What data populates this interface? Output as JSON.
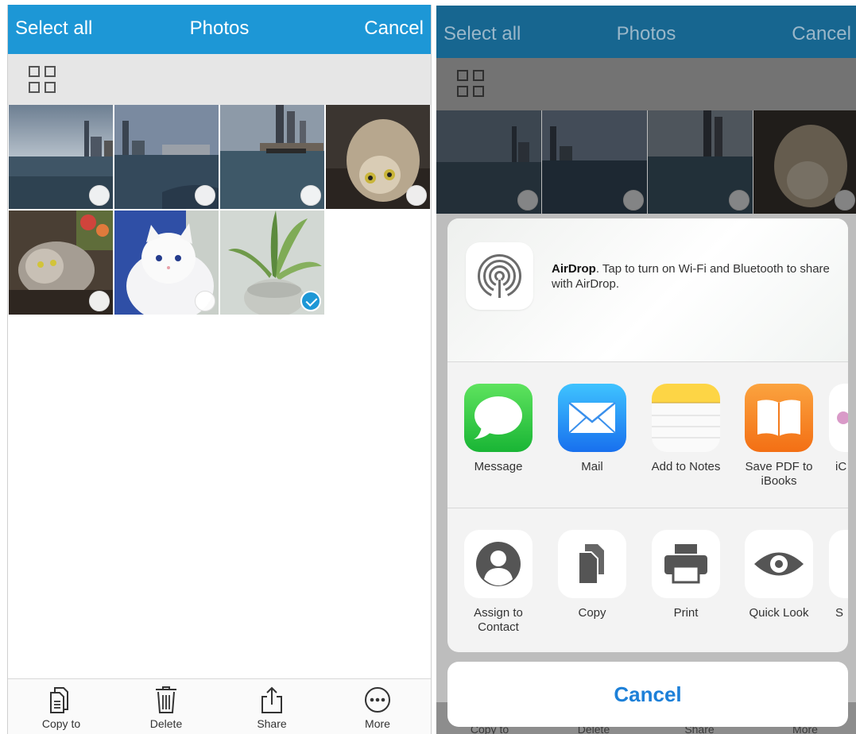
{
  "left": {
    "nav": {
      "select_all": "Select all",
      "title": "Photos",
      "cancel": "Cancel"
    },
    "photos": [
      {
        "kind": "harbor",
        "selected": false
      },
      {
        "kind": "harbor",
        "selected": false
      },
      {
        "kind": "harbor",
        "selected": false
      },
      {
        "kind": "cat",
        "selected": false
      },
      {
        "kind": "cat",
        "selected": false
      },
      {
        "kind": "cat",
        "selected": false
      },
      {
        "kind": "plant",
        "selected": true
      }
    ],
    "bottom": {
      "copy_to": "Copy to",
      "delete": "Delete",
      "share": "Share",
      "more": "More"
    }
  },
  "right": {
    "nav": {
      "select_all": "Select all",
      "title": "Photos",
      "cancel": "Cancel"
    },
    "airdrop": {
      "title": "AirDrop",
      "text": ". Tap to turn on Wi-Fi and Bluetooth to share with AirDrop."
    },
    "apps": [
      {
        "label": "Message",
        "icon": "message-icon"
      },
      {
        "label": "Mail",
        "icon": "mail-icon"
      },
      {
        "label": "Add to Notes",
        "icon": "notes-icon"
      },
      {
        "label": "Save PDF to iBooks",
        "icon": "ibooks-icon"
      },
      {
        "label": "iC",
        "icon": "partial-app-icon"
      }
    ],
    "actions": [
      {
        "label": "Assign to Contact",
        "icon": "contact-icon"
      },
      {
        "label": "Copy",
        "icon": "copy-icon"
      },
      {
        "label": "Print",
        "icon": "print-icon"
      },
      {
        "label": "Quick Look",
        "icon": "eye-icon"
      },
      {
        "label": "S",
        "icon": "partial-action-icon"
      }
    ],
    "cancel": "Cancel",
    "bottom": {
      "copy_to": "Copy to",
      "delete": "Delete",
      "share": "Share",
      "more": "More"
    }
  },
  "colors": {
    "nav_blue": "#1d97d6",
    "check_blue": "#1d97d6",
    "cancel_blue": "#1d80d8",
    "message_green": "#35c84a",
    "mail_blue": "#1f8df5",
    "notes_yellow": "#fdd545",
    "ibooks_orange": "#f6851f"
  }
}
